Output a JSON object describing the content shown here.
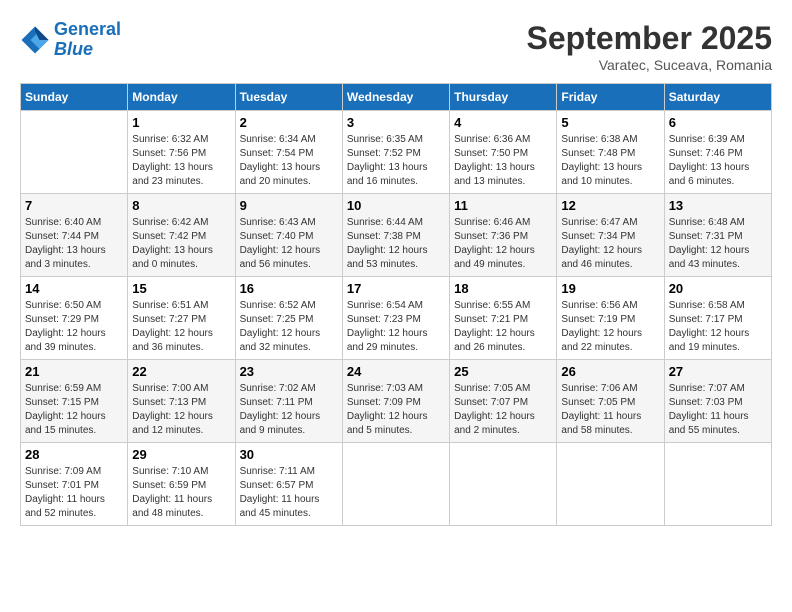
{
  "header": {
    "logo_line1": "General",
    "logo_line2": "Blue",
    "month_title": "September 2025",
    "location": "Varatec, Suceava, Romania"
  },
  "days_of_week": [
    "Sunday",
    "Monday",
    "Tuesday",
    "Wednesday",
    "Thursday",
    "Friday",
    "Saturday"
  ],
  "weeks": [
    [
      {
        "day": "",
        "sunrise": "",
        "sunset": "",
        "daylight": ""
      },
      {
        "day": "1",
        "sunrise": "Sunrise: 6:32 AM",
        "sunset": "Sunset: 7:56 PM",
        "daylight": "Daylight: 13 hours and 23 minutes."
      },
      {
        "day": "2",
        "sunrise": "Sunrise: 6:34 AM",
        "sunset": "Sunset: 7:54 PM",
        "daylight": "Daylight: 13 hours and 20 minutes."
      },
      {
        "day": "3",
        "sunrise": "Sunrise: 6:35 AM",
        "sunset": "Sunset: 7:52 PM",
        "daylight": "Daylight: 13 hours and 16 minutes."
      },
      {
        "day": "4",
        "sunrise": "Sunrise: 6:36 AM",
        "sunset": "Sunset: 7:50 PM",
        "daylight": "Daylight: 13 hours and 13 minutes."
      },
      {
        "day": "5",
        "sunrise": "Sunrise: 6:38 AM",
        "sunset": "Sunset: 7:48 PM",
        "daylight": "Daylight: 13 hours and 10 minutes."
      },
      {
        "day": "6",
        "sunrise": "Sunrise: 6:39 AM",
        "sunset": "Sunset: 7:46 PM",
        "daylight": "Daylight: 13 hours and 6 minutes."
      }
    ],
    [
      {
        "day": "7",
        "sunrise": "Sunrise: 6:40 AM",
        "sunset": "Sunset: 7:44 PM",
        "daylight": "Daylight: 13 hours and 3 minutes."
      },
      {
        "day": "8",
        "sunrise": "Sunrise: 6:42 AM",
        "sunset": "Sunset: 7:42 PM",
        "daylight": "Daylight: 13 hours and 0 minutes."
      },
      {
        "day": "9",
        "sunrise": "Sunrise: 6:43 AM",
        "sunset": "Sunset: 7:40 PM",
        "daylight": "Daylight: 12 hours and 56 minutes."
      },
      {
        "day": "10",
        "sunrise": "Sunrise: 6:44 AM",
        "sunset": "Sunset: 7:38 PM",
        "daylight": "Daylight: 12 hours and 53 minutes."
      },
      {
        "day": "11",
        "sunrise": "Sunrise: 6:46 AM",
        "sunset": "Sunset: 7:36 PM",
        "daylight": "Daylight: 12 hours and 49 minutes."
      },
      {
        "day": "12",
        "sunrise": "Sunrise: 6:47 AM",
        "sunset": "Sunset: 7:34 PM",
        "daylight": "Daylight: 12 hours and 46 minutes."
      },
      {
        "day": "13",
        "sunrise": "Sunrise: 6:48 AM",
        "sunset": "Sunset: 7:31 PM",
        "daylight": "Daylight: 12 hours and 43 minutes."
      }
    ],
    [
      {
        "day": "14",
        "sunrise": "Sunrise: 6:50 AM",
        "sunset": "Sunset: 7:29 PM",
        "daylight": "Daylight: 12 hours and 39 minutes."
      },
      {
        "day": "15",
        "sunrise": "Sunrise: 6:51 AM",
        "sunset": "Sunset: 7:27 PM",
        "daylight": "Daylight: 12 hours and 36 minutes."
      },
      {
        "day": "16",
        "sunrise": "Sunrise: 6:52 AM",
        "sunset": "Sunset: 7:25 PM",
        "daylight": "Daylight: 12 hours and 32 minutes."
      },
      {
        "day": "17",
        "sunrise": "Sunrise: 6:54 AM",
        "sunset": "Sunset: 7:23 PM",
        "daylight": "Daylight: 12 hours and 29 minutes."
      },
      {
        "day": "18",
        "sunrise": "Sunrise: 6:55 AM",
        "sunset": "Sunset: 7:21 PM",
        "daylight": "Daylight: 12 hours and 26 minutes."
      },
      {
        "day": "19",
        "sunrise": "Sunrise: 6:56 AM",
        "sunset": "Sunset: 7:19 PM",
        "daylight": "Daylight: 12 hours and 22 minutes."
      },
      {
        "day": "20",
        "sunrise": "Sunrise: 6:58 AM",
        "sunset": "Sunset: 7:17 PM",
        "daylight": "Daylight: 12 hours and 19 minutes."
      }
    ],
    [
      {
        "day": "21",
        "sunrise": "Sunrise: 6:59 AM",
        "sunset": "Sunset: 7:15 PM",
        "daylight": "Daylight: 12 hours and 15 minutes."
      },
      {
        "day": "22",
        "sunrise": "Sunrise: 7:00 AM",
        "sunset": "Sunset: 7:13 PM",
        "daylight": "Daylight: 12 hours and 12 minutes."
      },
      {
        "day": "23",
        "sunrise": "Sunrise: 7:02 AM",
        "sunset": "Sunset: 7:11 PM",
        "daylight": "Daylight: 12 hours and 9 minutes."
      },
      {
        "day": "24",
        "sunrise": "Sunrise: 7:03 AM",
        "sunset": "Sunset: 7:09 PM",
        "daylight": "Daylight: 12 hours and 5 minutes."
      },
      {
        "day": "25",
        "sunrise": "Sunrise: 7:05 AM",
        "sunset": "Sunset: 7:07 PM",
        "daylight": "Daylight: 12 hours and 2 minutes."
      },
      {
        "day": "26",
        "sunrise": "Sunrise: 7:06 AM",
        "sunset": "Sunset: 7:05 PM",
        "daylight": "Daylight: 11 hours and 58 minutes."
      },
      {
        "day": "27",
        "sunrise": "Sunrise: 7:07 AM",
        "sunset": "Sunset: 7:03 PM",
        "daylight": "Daylight: 11 hours and 55 minutes."
      }
    ],
    [
      {
        "day": "28",
        "sunrise": "Sunrise: 7:09 AM",
        "sunset": "Sunset: 7:01 PM",
        "daylight": "Daylight: 11 hours and 52 minutes."
      },
      {
        "day": "29",
        "sunrise": "Sunrise: 7:10 AM",
        "sunset": "Sunset: 6:59 PM",
        "daylight": "Daylight: 11 hours and 48 minutes."
      },
      {
        "day": "30",
        "sunrise": "Sunrise: 7:11 AM",
        "sunset": "Sunset: 6:57 PM",
        "daylight": "Daylight: 11 hours and 45 minutes."
      },
      {
        "day": "",
        "sunrise": "",
        "sunset": "",
        "daylight": ""
      },
      {
        "day": "",
        "sunrise": "",
        "sunset": "",
        "daylight": ""
      },
      {
        "day": "",
        "sunrise": "",
        "sunset": "",
        "daylight": ""
      },
      {
        "day": "",
        "sunrise": "",
        "sunset": "",
        "daylight": ""
      }
    ]
  ]
}
